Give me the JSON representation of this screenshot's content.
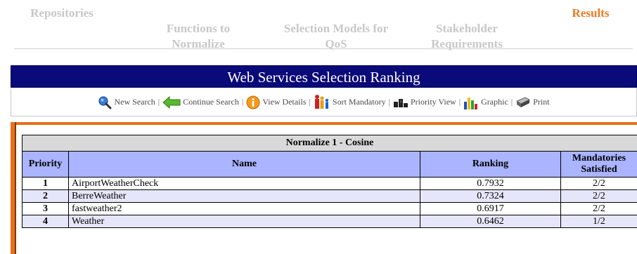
{
  "nav": {
    "items": [
      {
        "label": "Repositories",
        "active": false
      },
      {
        "label": "Functions to\nNormalize",
        "active": false
      },
      {
        "label": "Selection Models for\nQoS",
        "active": false
      },
      {
        "label": "Stakeholder\nRequirements",
        "active": false
      },
      {
        "label": "Results",
        "active": true
      }
    ],
    "active_color": "#f07a1e",
    "inactive_color": "#c8c8c8"
  },
  "panel": {
    "title": "Web Services Selection Ranking",
    "title_bg": "#0a0a78"
  },
  "toolbar": {
    "items": [
      {
        "label": "New Search",
        "icon": "magnifier-icon"
      },
      {
        "label": "Continue Search",
        "icon": "green-arrow-icon"
      },
      {
        "label": "View Details",
        "icon": "info-icon"
      },
      {
        "label": "Sort Mandatory",
        "icon": "people-icon"
      },
      {
        "label": "Priority View",
        "icon": "podium-icon"
      },
      {
        "label": "Graphic",
        "icon": "bar-chart-icon"
      },
      {
        "label": "Print",
        "icon": "printer-icon"
      }
    ],
    "separator": "|"
  },
  "table": {
    "caption": "Normalize 1 - Cosine",
    "headers": {
      "priority": "Priority",
      "name": "Name",
      "ranking": "Ranking",
      "mandatories": "Mandatories Satisfied"
    },
    "rows": [
      {
        "priority": "1",
        "name": "AirportWeatherCheck",
        "ranking": "0.7932",
        "mandatories": "2/2"
      },
      {
        "priority": "2",
        "name": "BerreWeather",
        "ranking": "0.7324",
        "mandatories": "2/2"
      },
      {
        "priority": "3",
        "name": "fastweather2",
        "ranking": "0.6917",
        "mandatories": "2/2"
      },
      {
        "priority": "4",
        "name": "Weather",
        "ranking": "0.6462",
        "mandatories": "1/2"
      }
    ],
    "header_bg": "#aab4ff",
    "alt_row_bg": "#e6e6fa"
  }
}
